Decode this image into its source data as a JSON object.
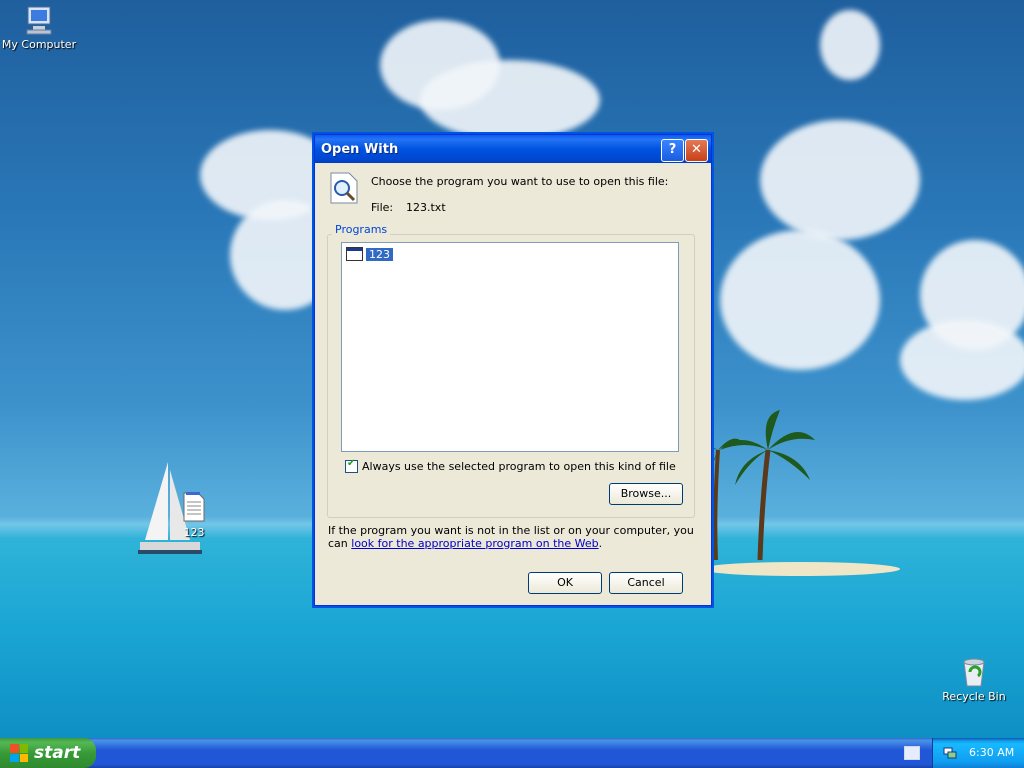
{
  "desktop": {
    "icons": [
      {
        "label": "My Computer",
        "icon": "my-computer-icon"
      },
      {
        "label": "123",
        "icon": "text-file-icon"
      },
      {
        "label": "Recycle Bin",
        "icon": "recycle-bin-icon"
      }
    ]
  },
  "dialog": {
    "title": "Open With",
    "help_button": "?",
    "close_button": "✕",
    "prompt": "Choose the program you want to use to open this file:",
    "file_label": "File:",
    "file_name": "123.txt",
    "group_title": "Programs",
    "programs": [
      {
        "label": "123",
        "selected": true
      }
    ],
    "always_use_label": "Always use the selected program to open this kind of file",
    "always_use_checked": true,
    "browse_label": "Browse...",
    "footer_text": "If the program you want is not in the list or on your computer, you can ",
    "footer_link": "look for the appropriate program on the Web",
    "footer_end": ".",
    "ok_label": "OK",
    "cancel_label": "Cancel"
  },
  "taskbar": {
    "start_label": "start",
    "clock": "6:30 AM"
  },
  "colors": {
    "titlebar": "#0053e1",
    "selection": "#316ac5",
    "link": "#0000c8",
    "start_green": "#379a37"
  }
}
